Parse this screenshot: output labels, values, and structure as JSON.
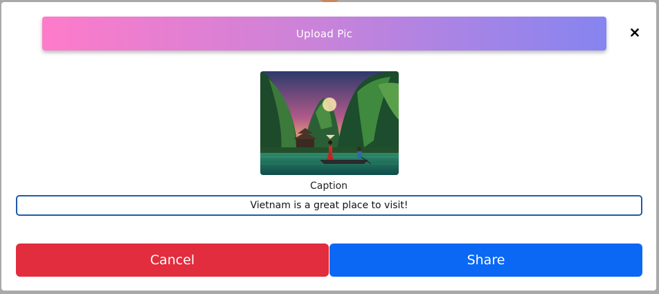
{
  "modal": {
    "upload_button_label": "Upload Pic",
    "close_icon": "close-icon",
    "image_alt": "Vietnam karst lake with boat",
    "caption_label": "Caption",
    "caption_value": "Vietnam is a great place to visit!",
    "cancel_label": "Cancel",
    "share_label": "Share"
  },
  "colors": {
    "upload_gradient_start": "#fe7bc9",
    "upload_gradient_end": "#8684f0",
    "cancel": "#e12d3d",
    "share": "#0a68f5",
    "input_border": "#1e5aa8"
  }
}
